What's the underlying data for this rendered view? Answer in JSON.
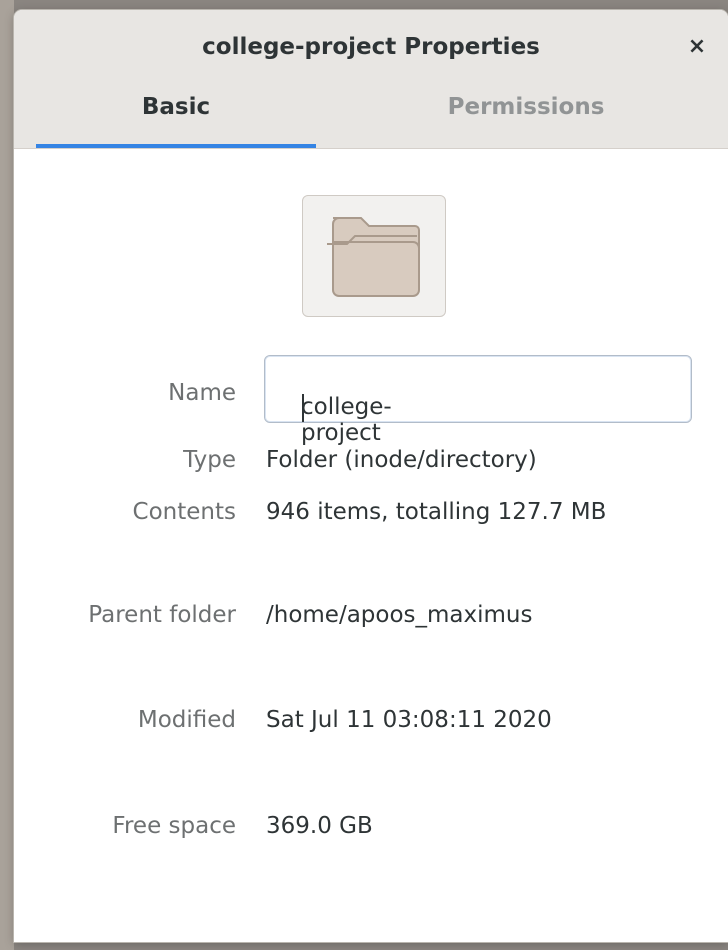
{
  "window": {
    "title": "college-project Properties",
    "close_symbol": "×"
  },
  "tabs": [
    {
      "label": "Basic",
      "active": true
    },
    {
      "label": "Permissions",
      "active": false
    }
  ],
  "icon": "folder-icon",
  "fields": {
    "name": {
      "label": "Name",
      "value": "college-project"
    },
    "type": {
      "label": "Type",
      "value": "Folder (inode/directory)"
    },
    "contents": {
      "label": "Contents",
      "value": "946 items, totalling 127.7 MB"
    },
    "parent": {
      "label": "Parent folder",
      "value": "/home/apoos_maximus"
    },
    "modified": {
      "label": "Modified",
      "value": "Sat Jul 11 03:08:11 2020"
    },
    "free_space": {
      "label": "Free space",
      "value": "369.0 GB"
    }
  },
  "colors": {
    "accent": "#3584e4",
    "folder": "#d8cbbf"
  }
}
